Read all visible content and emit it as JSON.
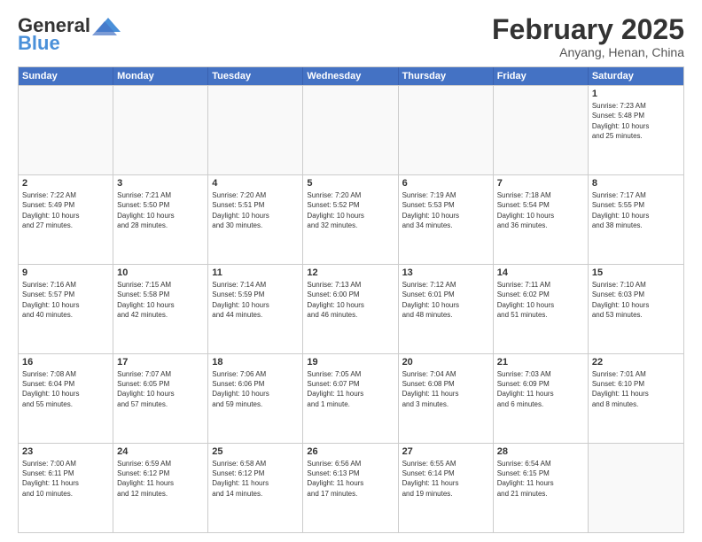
{
  "header": {
    "logo_general": "General",
    "logo_blue": "Blue",
    "month_year": "February 2025",
    "location": "Anyang, Henan, China"
  },
  "days_of_week": [
    "Sunday",
    "Monday",
    "Tuesday",
    "Wednesday",
    "Thursday",
    "Friday",
    "Saturday"
  ],
  "rows": [
    [
      {
        "day": "",
        "info": ""
      },
      {
        "day": "",
        "info": ""
      },
      {
        "day": "",
        "info": ""
      },
      {
        "day": "",
        "info": ""
      },
      {
        "day": "",
        "info": ""
      },
      {
        "day": "",
        "info": ""
      },
      {
        "day": "1",
        "info": "Sunrise: 7:23 AM\nSunset: 5:48 PM\nDaylight: 10 hours\nand 25 minutes."
      }
    ],
    [
      {
        "day": "2",
        "info": "Sunrise: 7:22 AM\nSunset: 5:49 PM\nDaylight: 10 hours\nand 27 minutes."
      },
      {
        "day": "3",
        "info": "Sunrise: 7:21 AM\nSunset: 5:50 PM\nDaylight: 10 hours\nand 28 minutes."
      },
      {
        "day": "4",
        "info": "Sunrise: 7:20 AM\nSunset: 5:51 PM\nDaylight: 10 hours\nand 30 minutes."
      },
      {
        "day": "5",
        "info": "Sunrise: 7:20 AM\nSunset: 5:52 PM\nDaylight: 10 hours\nand 32 minutes."
      },
      {
        "day": "6",
        "info": "Sunrise: 7:19 AM\nSunset: 5:53 PM\nDaylight: 10 hours\nand 34 minutes."
      },
      {
        "day": "7",
        "info": "Sunrise: 7:18 AM\nSunset: 5:54 PM\nDaylight: 10 hours\nand 36 minutes."
      },
      {
        "day": "8",
        "info": "Sunrise: 7:17 AM\nSunset: 5:55 PM\nDaylight: 10 hours\nand 38 minutes."
      }
    ],
    [
      {
        "day": "9",
        "info": "Sunrise: 7:16 AM\nSunset: 5:57 PM\nDaylight: 10 hours\nand 40 minutes."
      },
      {
        "day": "10",
        "info": "Sunrise: 7:15 AM\nSunset: 5:58 PM\nDaylight: 10 hours\nand 42 minutes."
      },
      {
        "day": "11",
        "info": "Sunrise: 7:14 AM\nSunset: 5:59 PM\nDaylight: 10 hours\nand 44 minutes."
      },
      {
        "day": "12",
        "info": "Sunrise: 7:13 AM\nSunset: 6:00 PM\nDaylight: 10 hours\nand 46 minutes."
      },
      {
        "day": "13",
        "info": "Sunrise: 7:12 AM\nSunset: 6:01 PM\nDaylight: 10 hours\nand 48 minutes."
      },
      {
        "day": "14",
        "info": "Sunrise: 7:11 AM\nSunset: 6:02 PM\nDaylight: 10 hours\nand 51 minutes."
      },
      {
        "day": "15",
        "info": "Sunrise: 7:10 AM\nSunset: 6:03 PM\nDaylight: 10 hours\nand 53 minutes."
      }
    ],
    [
      {
        "day": "16",
        "info": "Sunrise: 7:08 AM\nSunset: 6:04 PM\nDaylight: 10 hours\nand 55 minutes."
      },
      {
        "day": "17",
        "info": "Sunrise: 7:07 AM\nSunset: 6:05 PM\nDaylight: 10 hours\nand 57 minutes."
      },
      {
        "day": "18",
        "info": "Sunrise: 7:06 AM\nSunset: 6:06 PM\nDaylight: 10 hours\nand 59 minutes."
      },
      {
        "day": "19",
        "info": "Sunrise: 7:05 AM\nSunset: 6:07 PM\nDaylight: 11 hours\nand 1 minute."
      },
      {
        "day": "20",
        "info": "Sunrise: 7:04 AM\nSunset: 6:08 PM\nDaylight: 11 hours\nand 3 minutes."
      },
      {
        "day": "21",
        "info": "Sunrise: 7:03 AM\nSunset: 6:09 PM\nDaylight: 11 hours\nand 6 minutes."
      },
      {
        "day": "22",
        "info": "Sunrise: 7:01 AM\nSunset: 6:10 PM\nDaylight: 11 hours\nand 8 minutes."
      }
    ],
    [
      {
        "day": "23",
        "info": "Sunrise: 7:00 AM\nSunset: 6:11 PM\nDaylight: 11 hours\nand 10 minutes."
      },
      {
        "day": "24",
        "info": "Sunrise: 6:59 AM\nSunset: 6:12 PM\nDaylight: 11 hours\nand 12 minutes."
      },
      {
        "day": "25",
        "info": "Sunrise: 6:58 AM\nSunset: 6:12 PM\nDaylight: 11 hours\nand 14 minutes."
      },
      {
        "day": "26",
        "info": "Sunrise: 6:56 AM\nSunset: 6:13 PM\nDaylight: 11 hours\nand 17 minutes."
      },
      {
        "day": "27",
        "info": "Sunrise: 6:55 AM\nSunset: 6:14 PM\nDaylight: 11 hours\nand 19 minutes."
      },
      {
        "day": "28",
        "info": "Sunrise: 6:54 AM\nSunset: 6:15 PM\nDaylight: 11 hours\nand 21 minutes."
      },
      {
        "day": "",
        "info": ""
      }
    ]
  ]
}
